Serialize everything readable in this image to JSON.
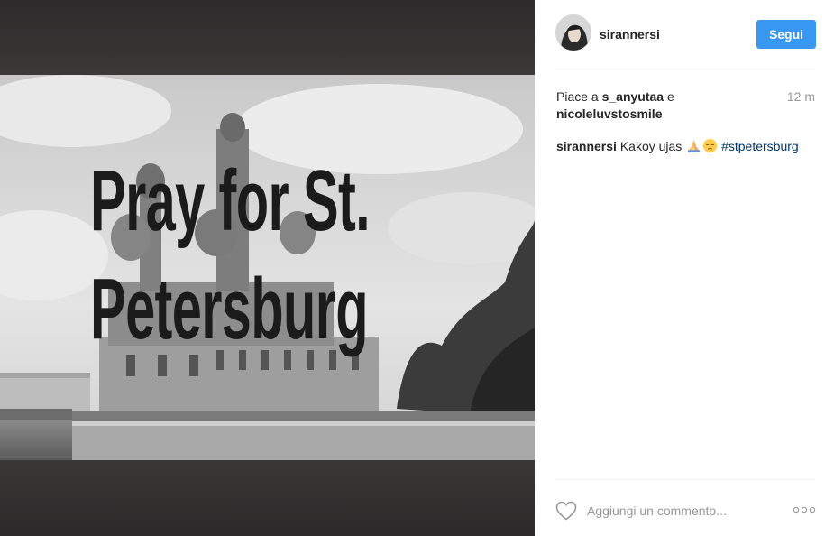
{
  "post": {
    "overlay_line1": "Pray for St.",
    "overlay_line2": "Petersburg"
  },
  "header": {
    "username": "sirannersi",
    "follow_label": "Segui"
  },
  "likes": {
    "prefix": "Piace a ",
    "user1": "s_anyutaa",
    "conj": " e",
    "user2": "nicoleluvstosmile",
    "time": "12 m"
  },
  "caption": {
    "username": "sirannersi",
    "text": " Kakoy ujas ",
    "emojis": [
      "praying-hands-icon",
      "pensive-face-icon"
    ],
    "hashtag": "#stpetersburg"
  },
  "footer": {
    "comment_placeholder": "Aggiungi un commento..."
  },
  "colors": {
    "follow_button": "#3897f0",
    "hashtag": "#003569",
    "muted": "#999999"
  }
}
